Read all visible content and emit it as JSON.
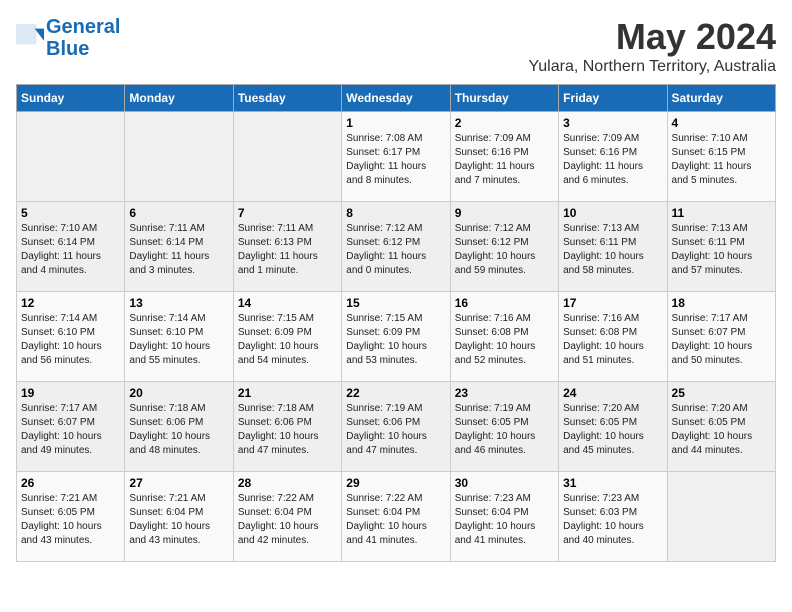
{
  "logo": {
    "line1": "General",
    "line2": "Blue"
  },
  "title": "May 2024",
  "subtitle": "Yulara, Northern Territory, Australia",
  "days_of_week": [
    "Sunday",
    "Monday",
    "Tuesday",
    "Wednesday",
    "Thursday",
    "Friday",
    "Saturday"
  ],
  "weeks": [
    [
      {
        "num": "",
        "info": ""
      },
      {
        "num": "",
        "info": ""
      },
      {
        "num": "",
        "info": ""
      },
      {
        "num": "1",
        "info": "Sunrise: 7:08 AM\nSunset: 6:17 PM\nDaylight: 11 hours\nand 8 minutes."
      },
      {
        "num": "2",
        "info": "Sunrise: 7:09 AM\nSunset: 6:16 PM\nDaylight: 11 hours\nand 7 minutes."
      },
      {
        "num": "3",
        "info": "Sunrise: 7:09 AM\nSunset: 6:16 PM\nDaylight: 11 hours\nand 6 minutes."
      },
      {
        "num": "4",
        "info": "Sunrise: 7:10 AM\nSunset: 6:15 PM\nDaylight: 11 hours\nand 5 minutes."
      }
    ],
    [
      {
        "num": "5",
        "info": "Sunrise: 7:10 AM\nSunset: 6:14 PM\nDaylight: 11 hours\nand 4 minutes."
      },
      {
        "num": "6",
        "info": "Sunrise: 7:11 AM\nSunset: 6:14 PM\nDaylight: 11 hours\nand 3 minutes."
      },
      {
        "num": "7",
        "info": "Sunrise: 7:11 AM\nSunset: 6:13 PM\nDaylight: 11 hours\nand 1 minute."
      },
      {
        "num": "8",
        "info": "Sunrise: 7:12 AM\nSunset: 6:12 PM\nDaylight: 11 hours\nand 0 minutes."
      },
      {
        "num": "9",
        "info": "Sunrise: 7:12 AM\nSunset: 6:12 PM\nDaylight: 10 hours\nand 59 minutes."
      },
      {
        "num": "10",
        "info": "Sunrise: 7:13 AM\nSunset: 6:11 PM\nDaylight: 10 hours\nand 58 minutes."
      },
      {
        "num": "11",
        "info": "Sunrise: 7:13 AM\nSunset: 6:11 PM\nDaylight: 10 hours\nand 57 minutes."
      }
    ],
    [
      {
        "num": "12",
        "info": "Sunrise: 7:14 AM\nSunset: 6:10 PM\nDaylight: 10 hours\nand 56 minutes."
      },
      {
        "num": "13",
        "info": "Sunrise: 7:14 AM\nSunset: 6:10 PM\nDaylight: 10 hours\nand 55 minutes."
      },
      {
        "num": "14",
        "info": "Sunrise: 7:15 AM\nSunset: 6:09 PM\nDaylight: 10 hours\nand 54 minutes."
      },
      {
        "num": "15",
        "info": "Sunrise: 7:15 AM\nSunset: 6:09 PM\nDaylight: 10 hours\nand 53 minutes."
      },
      {
        "num": "16",
        "info": "Sunrise: 7:16 AM\nSunset: 6:08 PM\nDaylight: 10 hours\nand 52 minutes."
      },
      {
        "num": "17",
        "info": "Sunrise: 7:16 AM\nSunset: 6:08 PM\nDaylight: 10 hours\nand 51 minutes."
      },
      {
        "num": "18",
        "info": "Sunrise: 7:17 AM\nSunset: 6:07 PM\nDaylight: 10 hours\nand 50 minutes."
      }
    ],
    [
      {
        "num": "19",
        "info": "Sunrise: 7:17 AM\nSunset: 6:07 PM\nDaylight: 10 hours\nand 49 minutes."
      },
      {
        "num": "20",
        "info": "Sunrise: 7:18 AM\nSunset: 6:06 PM\nDaylight: 10 hours\nand 48 minutes."
      },
      {
        "num": "21",
        "info": "Sunrise: 7:18 AM\nSunset: 6:06 PM\nDaylight: 10 hours\nand 47 minutes."
      },
      {
        "num": "22",
        "info": "Sunrise: 7:19 AM\nSunset: 6:06 PM\nDaylight: 10 hours\nand 47 minutes."
      },
      {
        "num": "23",
        "info": "Sunrise: 7:19 AM\nSunset: 6:05 PM\nDaylight: 10 hours\nand 46 minutes."
      },
      {
        "num": "24",
        "info": "Sunrise: 7:20 AM\nSunset: 6:05 PM\nDaylight: 10 hours\nand 45 minutes."
      },
      {
        "num": "25",
        "info": "Sunrise: 7:20 AM\nSunset: 6:05 PM\nDaylight: 10 hours\nand 44 minutes."
      }
    ],
    [
      {
        "num": "26",
        "info": "Sunrise: 7:21 AM\nSunset: 6:05 PM\nDaylight: 10 hours\nand 43 minutes."
      },
      {
        "num": "27",
        "info": "Sunrise: 7:21 AM\nSunset: 6:04 PM\nDaylight: 10 hours\nand 43 minutes."
      },
      {
        "num": "28",
        "info": "Sunrise: 7:22 AM\nSunset: 6:04 PM\nDaylight: 10 hours\nand 42 minutes."
      },
      {
        "num": "29",
        "info": "Sunrise: 7:22 AM\nSunset: 6:04 PM\nDaylight: 10 hours\nand 41 minutes."
      },
      {
        "num": "30",
        "info": "Sunrise: 7:23 AM\nSunset: 6:04 PM\nDaylight: 10 hours\nand 41 minutes."
      },
      {
        "num": "31",
        "info": "Sunrise: 7:23 AM\nSunset: 6:03 PM\nDaylight: 10 hours\nand 40 minutes."
      },
      {
        "num": "",
        "info": ""
      }
    ]
  ]
}
